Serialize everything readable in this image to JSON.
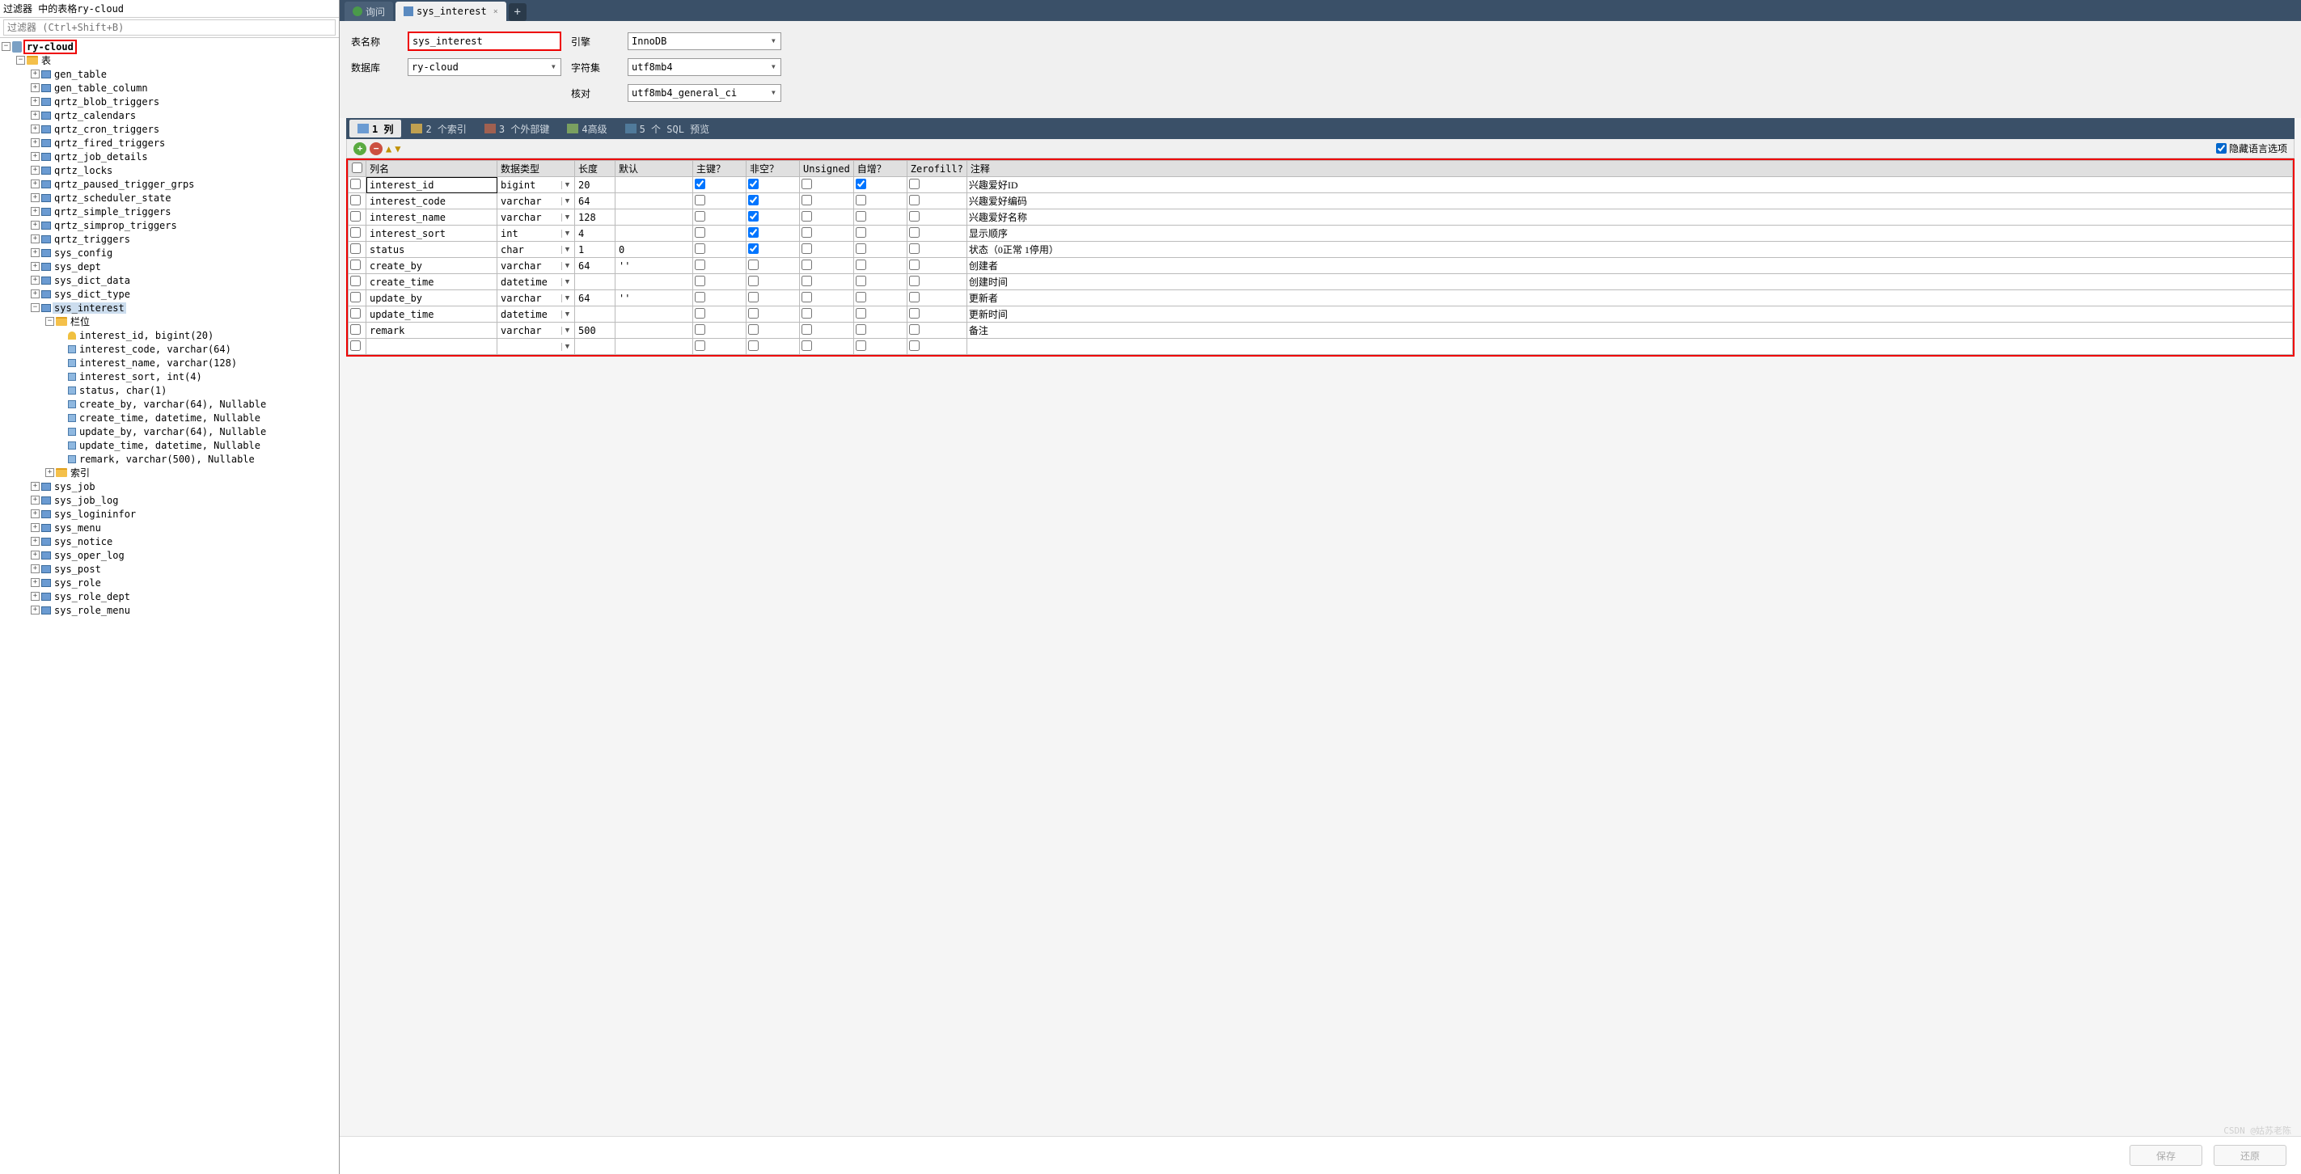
{
  "filter": {
    "title": "过滤器 中的表格ry-cloud",
    "placeholder": "过滤器 (Ctrl+Shift+B)"
  },
  "tree": {
    "root": "ry-cloud",
    "tableFolder": "表",
    "tables": [
      "gen_table",
      "gen_table_column",
      "qrtz_blob_triggers",
      "qrtz_calendars",
      "qrtz_cron_triggers",
      "qrtz_fired_triggers",
      "qrtz_job_details",
      "qrtz_locks",
      "qrtz_paused_trigger_grps",
      "qrtz_scheduler_state",
      "qrtz_simple_triggers",
      "qrtz_simprop_triggers",
      "qrtz_triggers",
      "sys_config",
      "sys_dept",
      "sys_dict_data",
      "sys_dict_type"
    ],
    "sysInterest": "sys_interest",
    "columnsFolder": "栏位",
    "columns": [
      "interest_id, bigint(20)",
      "interest_code, varchar(64)",
      "interest_name, varchar(128)",
      "interest_sort, int(4)",
      "status, char(1)",
      "create_by, varchar(64), Nullable",
      "create_time, datetime, Nullable",
      "update_by, varchar(64), Nullable",
      "update_time, datetime, Nullable",
      "remark, varchar(500), Nullable"
    ],
    "indexFolder": "索引",
    "tablesAfter": [
      "sys_job",
      "sys_job_log",
      "sys_logininfor",
      "sys_menu",
      "sys_notice",
      "sys_oper_log",
      "sys_post",
      "sys_role",
      "sys_role_dept",
      "sys_role_menu"
    ]
  },
  "tabs": {
    "query": "询问",
    "active": "sys_interest"
  },
  "form": {
    "tableNameLabel": "表名称",
    "tableName": "sys_interest",
    "engineLabel": "引擎",
    "engine": "InnoDB",
    "dbLabel": "数据库",
    "db": "ry-cloud",
    "charsetLabel": "字符集",
    "charset": "utf8mb4",
    "collationLabel": "核对",
    "collation": "utf8mb4_general_ci"
  },
  "subtabs": {
    "cols": "1 列",
    "idx": "2 个索引",
    "fk": "3 个外部键",
    "adv": "4高级",
    "sql": "5 个 SQL 预览"
  },
  "toolbar": {
    "hideLang": "隐藏语言选项"
  },
  "gridHeaders": {
    "name": "列名",
    "type": "数据类型",
    "len": "长度",
    "def": "默认",
    "pk": "主键？",
    "nn": "非空？",
    "un": "Unsigned",
    "ai": "自增？",
    "zf": "Zerofill?",
    "cmt": "注释"
  },
  "gridRows": [
    {
      "name": "interest_id",
      "type": "bigint",
      "len": "20",
      "def": "",
      "pk": true,
      "nn": true,
      "un": false,
      "ai": true,
      "zf": false,
      "cmt": "兴趣爱好ID"
    },
    {
      "name": "interest_code",
      "type": "varchar",
      "len": "64",
      "def": "",
      "pk": false,
      "nn": true,
      "un": false,
      "ai": false,
      "zf": false,
      "cmt": "兴趣爱好编码"
    },
    {
      "name": "interest_name",
      "type": "varchar",
      "len": "128",
      "def": "",
      "pk": false,
      "nn": true,
      "un": false,
      "ai": false,
      "zf": false,
      "cmt": "兴趣爱好名称"
    },
    {
      "name": "interest_sort",
      "type": "int",
      "len": "4",
      "def": "",
      "pk": false,
      "nn": true,
      "un": false,
      "ai": false,
      "zf": false,
      "cmt": "显示顺序"
    },
    {
      "name": "status",
      "type": "char",
      "len": "1",
      "def": "0",
      "pk": false,
      "nn": true,
      "un": false,
      "ai": false,
      "zf": false,
      "cmt": "状态（0正常 1停用）"
    },
    {
      "name": "create_by",
      "type": "varchar",
      "len": "64",
      "def": "''",
      "pk": false,
      "nn": false,
      "un": false,
      "ai": false,
      "zf": false,
      "cmt": "创建者"
    },
    {
      "name": "create_time",
      "type": "datetime",
      "len": "",
      "def": "",
      "pk": false,
      "nn": false,
      "un": false,
      "ai": false,
      "zf": false,
      "cmt": "创建时间"
    },
    {
      "name": "update_by",
      "type": "varchar",
      "len": "64",
      "def": "''",
      "pk": false,
      "nn": false,
      "un": false,
      "ai": false,
      "zf": false,
      "cmt": "更新者"
    },
    {
      "name": "update_time",
      "type": "datetime",
      "len": "",
      "def": "",
      "pk": false,
      "nn": false,
      "un": false,
      "ai": false,
      "zf": false,
      "cmt": "更新时间"
    },
    {
      "name": "remark",
      "type": "varchar",
      "len": "500",
      "def": "",
      "pk": false,
      "nn": false,
      "un": false,
      "ai": false,
      "zf": false,
      "cmt": "备注"
    }
  ],
  "buttons": {
    "save": "保存",
    "revert": "还原"
  },
  "watermark": "CSDN @姑苏老陈"
}
